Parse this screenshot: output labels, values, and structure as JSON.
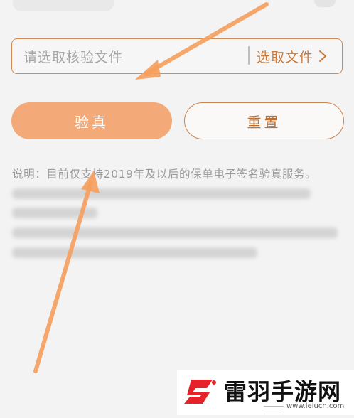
{
  "file_picker": {
    "placeholder": "请选取核验文件",
    "choose_label": "选取文件"
  },
  "actions": {
    "verify_label": "验真",
    "reset_label": "重置"
  },
  "note": {
    "text": "说明：目前仅支持2019年及以后的保单电子签名验真服务。"
  },
  "watermark": {
    "name": "雷羽手游网",
    "url": "www.leiucn.com"
  },
  "colors": {
    "accent": "#c97b3e",
    "primary_button": "#f4aa78",
    "arrow": "#f5a060",
    "background": "#f3f3f3"
  },
  "icons": {
    "chevron": "chevron-right-icon",
    "logo": "brand-logo-icon"
  }
}
